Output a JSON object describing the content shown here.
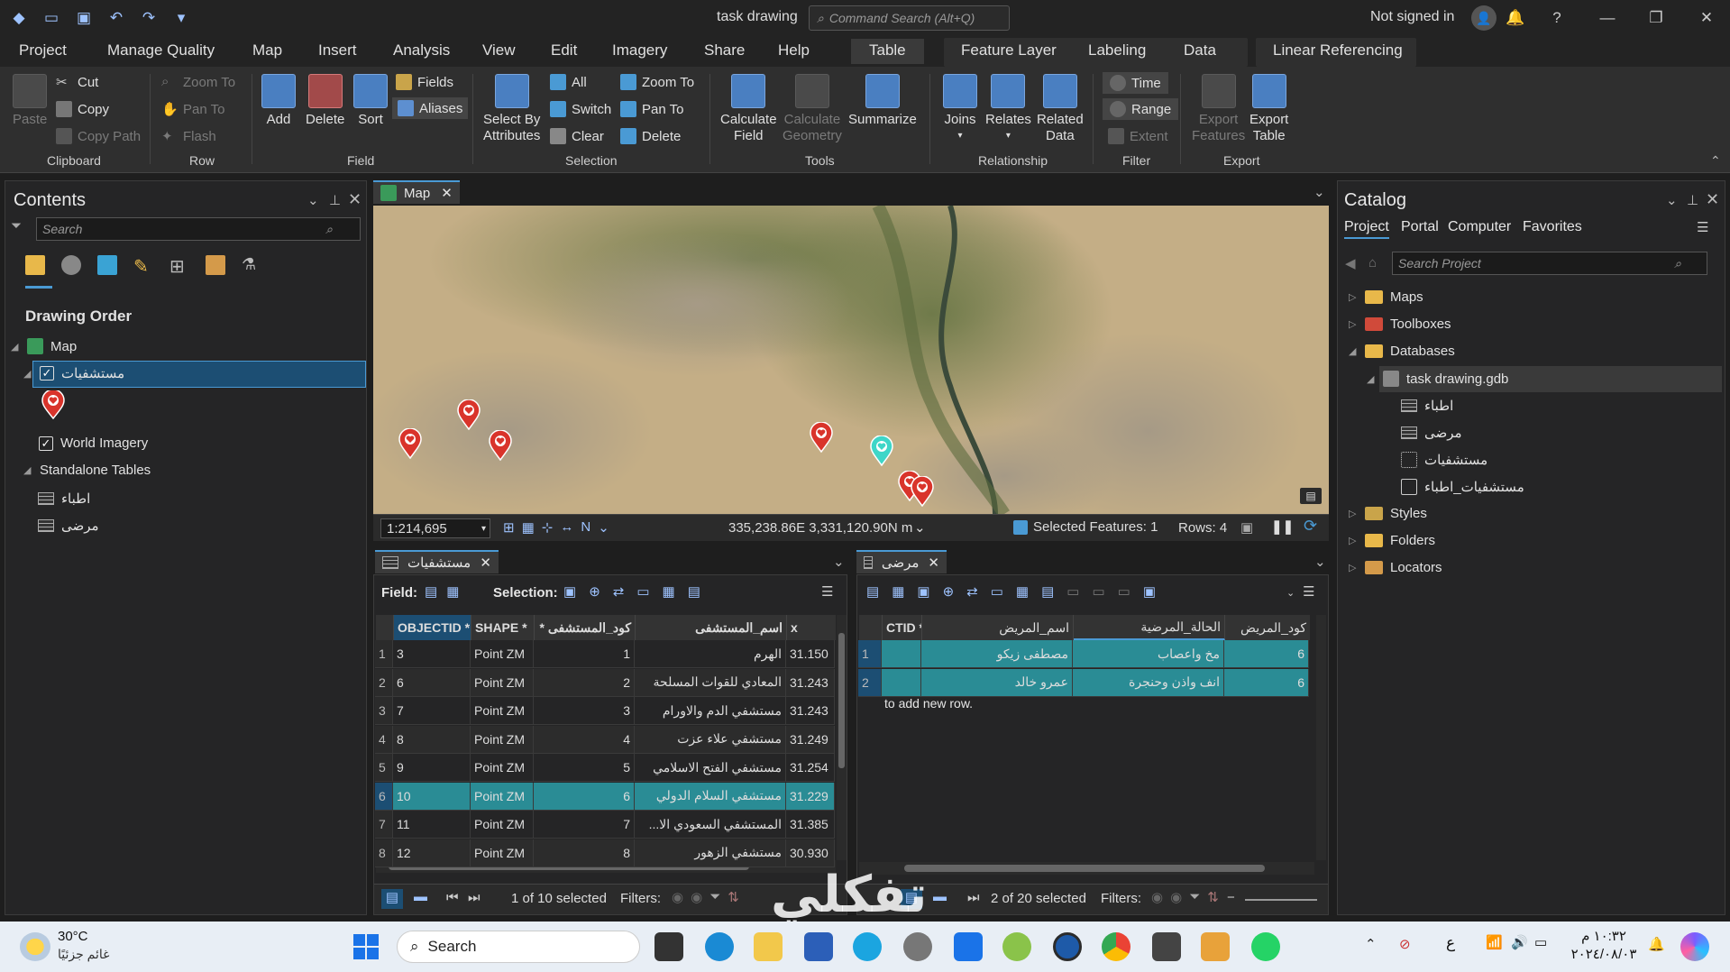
{
  "window": {
    "title": "task drawing",
    "command_search_placeholder": "Command Search (Alt+Q)",
    "signin": "Not signed in"
  },
  "ribbon_tabs": [
    "Project",
    "Manage Quality",
    "Map",
    "Insert",
    "Analysis",
    "View",
    "Edit",
    "Imagery",
    "Share",
    "Help",
    "Table",
    "Feature Layer",
    "Labeling",
    "Data",
    "Linear Referencing"
  ],
  "ribbon": {
    "clipboard": {
      "label": "Clipboard",
      "paste": "Paste",
      "cut": "Cut",
      "copy": "Copy",
      "copy_path": "Copy Path"
    },
    "row": {
      "label": "Row",
      "zoom_to": "Zoom To",
      "pan_to": "Pan To",
      "flash": "Flash"
    },
    "field": {
      "label": "Field",
      "add": "Add",
      "delete": "Delete",
      "sort": "Sort",
      "fields": "Fields",
      "aliases": "Aliases"
    },
    "selection": {
      "label": "Selection",
      "select_by_attributes_1": "Select By",
      "select_by_attributes_2": "Attributes",
      "all": "All",
      "switch": "Switch",
      "clear": "Clear",
      "zoom_to": "Zoom To",
      "pan_to": "Pan To",
      "delete": "Delete"
    },
    "tools": {
      "label": "Tools",
      "calc_field_1": "Calculate",
      "calc_field_2": "Field",
      "calc_geom_1": "Calculate",
      "calc_geom_2": "Geometry",
      "summarize": "Summarize"
    },
    "relationship": {
      "label": "Relationship",
      "joins": "Joins",
      "relates": "Relates",
      "related_1": "Related",
      "related_2": "Data"
    },
    "filter": {
      "label": "Filter",
      "time": "Time",
      "range": "Range",
      "extent": "Extent"
    },
    "export": {
      "label": "Export",
      "export_features_1": "Export",
      "export_features_2": "Features",
      "export_table_1": "Export",
      "export_table_2": "Table"
    }
  },
  "contents": {
    "title": "Contents",
    "search_placeholder": "Search",
    "drawing_order": "Drawing Order",
    "map": "Map",
    "layer_hospitals": "مستشفيات",
    "world_imagery": "World Imagery",
    "standalone_tables": "Standalone Tables",
    "table_doctors": "اطباء",
    "table_patients": "مرضى"
  },
  "map": {
    "tab": "Map",
    "scale": "1:214,695",
    "coords": "335,238.86E 3,331,120.90N m",
    "selected_features": "Selected Features: 1",
    "rows": "Rows: 4"
  },
  "hospitals_table": {
    "tab": "مستشفيات",
    "field_label": "Field:",
    "selection_label": "Selection:",
    "columns": [
      "OBJECTID *",
      "SHAPE *",
      "كود_المستشفى *",
      "اسم_المستشفى",
      "x"
    ],
    "rows": [
      {
        "n": "1",
        "oid": "3",
        "shape": "Point ZM",
        "code": "1",
        "name": "الهرم",
        "x": "31.150"
      },
      {
        "n": "2",
        "oid": "6",
        "shape": "Point ZM",
        "code": "2",
        "name": "المعادي للقوات المسلحة",
        "x": "31.243"
      },
      {
        "n": "3",
        "oid": "7",
        "shape": "Point ZM",
        "code": "3",
        "name": "مستشفي الدم والاورام",
        "x": "31.243"
      },
      {
        "n": "4",
        "oid": "8",
        "shape": "Point ZM",
        "code": "4",
        "name": "مستشفي علاء عزت",
        "x": "31.249"
      },
      {
        "n": "5",
        "oid": "9",
        "shape": "Point ZM",
        "code": "5",
        "name": "مستشفي الفتح الاسلامي",
        "x": "31.254"
      },
      {
        "n": "6",
        "oid": "10",
        "shape": "Point ZM",
        "code": "6",
        "name": "مستشفي السلام الدولي",
        "x": "31.229"
      },
      {
        "n": "7",
        "oid": "11",
        "shape": "Point ZM",
        "code": "7",
        "name": "المستشفي السعودي الا...",
        "x": "31.385"
      },
      {
        "n": "8",
        "oid": "12",
        "shape": "Point ZM",
        "code": "8",
        "name": "مستشفي الزهور",
        "x": "30.930"
      }
    ],
    "status": "1 of 10 selected",
    "filters": "Filters:"
  },
  "patients_table": {
    "tab": "مرضى",
    "columns": [
      "CTID *",
      "اسم_المريض",
      "الحالة_المرضية",
      "كود_المريض"
    ],
    "rows": [
      {
        "n": "1",
        "oid": "",
        "name": "مصطفى زيكو",
        "case": "مخ واعصاب",
        "code": "6"
      },
      {
        "n": "2",
        "oid": "",
        "name": "عمرو خالد",
        "case": "انف واذن وحنجرة",
        "code": "6"
      }
    ],
    "new_row": "to add new row.",
    "status": "2 of 20 selected",
    "filters": "Filters:"
  },
  "catalog": {
    "title": "Catalog",
    "tabs": [
      "Project",
      "Portal",
      "Computer",
      "Favorites"
    ],
    "search_placeholder": "Search Project",
    "maps": "Maps",
    "toolboxes": "Toolboxes",
    "databases": "Databases",
    "gdb": "task drawing.gdb",
    "gdb_items": [
      "اطباء",
      "مرضى",
      "مستشفيات",
      "مستشفيات_اطباء"
    ],
    "styles": "Styles",
    "folders": "Folders",
    "locators": "Locators"
  },
  "taskbar": {
    "weather_temp": "30°C",
    "weather_desc": "غائم جزئيًا",
    "search": "Search",
    "time": "١٠:٣٢ م",
    "date": "٢٠٢٤/٠٨/٠٣",
    "lang": "ع"
  },
  "watermark": "تفكلي",
  "colors": {
    "accent": "#4a9ad4",
    "selection": "#2a8c95",
    "marker": "#d9342b"
  }
}
